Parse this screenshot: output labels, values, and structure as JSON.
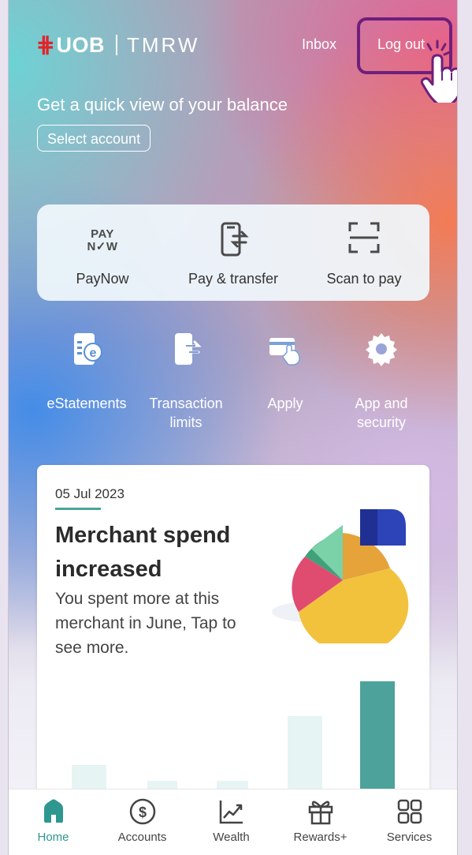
{
  "header": {
    "logo": {
      "brand": "UOB",
      "product": "TMRW"
    },
    "inbox_label": "Inbox",
    "logout_label": "Log out"
  },
  "balance": {
    "title": "Get a quick view of your balance",
    "select_account_label": "Select account"
  },
  "quick_actions": [
    {
      "label": "PayNow",
      "icon": "paynow-logo-icon"
    },
    {
      "label": "Pay & transfer",
      "icon": "phone-transfer-icon"
    },
    {
      "label": "Scan to pay",
      "icon": "scan-icon"
    }
  ],
  "actions": [
    {
      "label": "eStatements",
      "icon": "estatement-icon"
    },
    {
      "label": "Transaction limits",
      "icon": "transaction-limit-icon"
    },
    {
      "label": "Apply",
      "icon": "card-apply-icon"
    },
    {
      "label": "App and security",
      "icon": "gear-icon"
    }
  ],
  "insight_card": {
    "date": "05 Jul 2023",
    "headline": "Merchant spend increased",
    "body": "You spent more at this merchant in June, Tap to see more."
  },
  "tabbar": [
    {
      "label": "Home",
      "icon": "home-icon",
      "active": true
    },
    {
      "label": "Accounts",
      "icon": "dollar-circle-icon",
      "active": false
    },
    {
      "label": "Wealth",
      "icon": "trend-chart-icon",
      "active": false
    },
    {
      "label": "Rewards+",
      "icon": "gift-icon",
      "active": false
    },
    {
      "label": "Services",
      "icon": "grid-icon",
      "active": false
    }
  ],
  "colors": {
    "accent": "#4da39b",
    "brand_red": "#e1242a",
    "highlight_box": "#6f1f7b"
  }
}
